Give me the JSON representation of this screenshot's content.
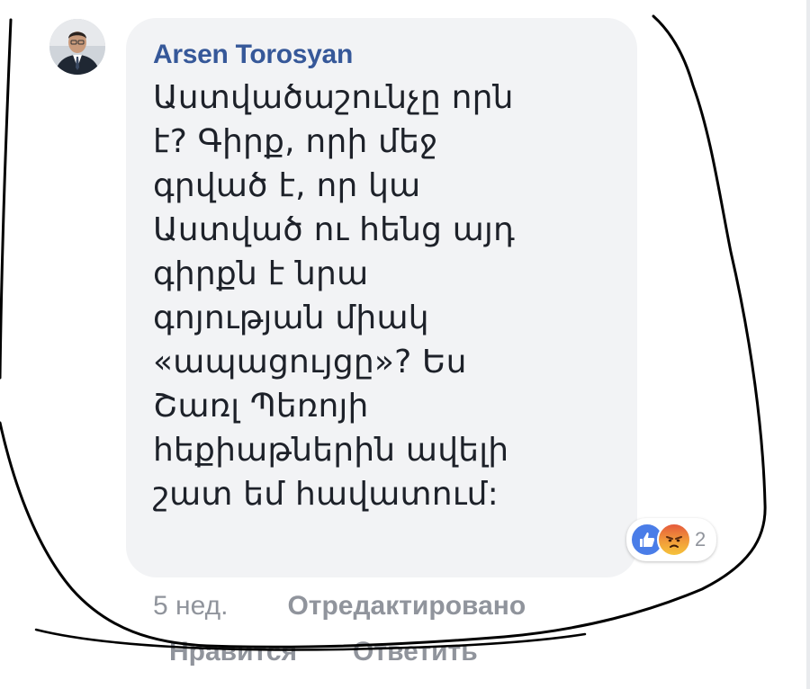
{
  "comment": {
    "author": "Arsen Torosyan",
    "text_lines": [
      "Աստվածաշունչը որն",
      "է? Գիրք, որի մեջ",
      "գրված է, որ կա",
      "Աստված ու հենց այդ",
      "գիրքն է նրա",
      "գոյության միակ",
      "«ապացույցը»? Ես",
      "Շառլ Պեռոյի",
      "հեքիաթներին ավելի",
      "շատ եմ հավատում:"
    ],
    "reactions": {
      "icons": [
        "like-icon",
        "angry-icon"
      ],
      "count": "2"
    },
    "meta": {
      "time": "5 нед.",
      "edited": "Отредактировано"
    },
    "actions": {
      "like": "Нравится",
      "reply": "Ответить"
    }
  },
  "colors": {
    "author": "#365899",
    "text": "#1d2129",
    "bubble": "#f2f3f5",
    "meta": "#90949c",
    "like": "#4a7de8",
    "scribble": "#000000"
  }
}
